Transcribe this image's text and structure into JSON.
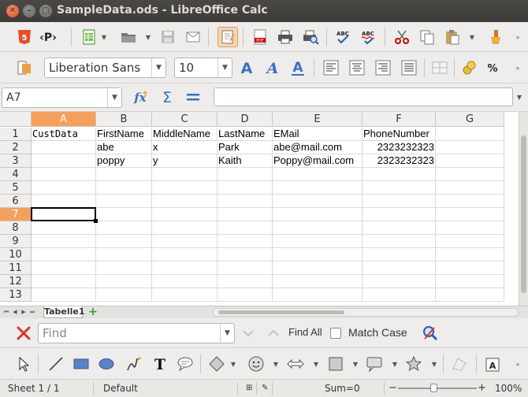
{
  "window": {
    "title": "SampleData.ods - LibreOffice Calc"
  },
  "formatting": {
    "font_name": "Liberation Sans",
    "font_size": "10"
  },
  "formula_bar": {
    "name_box": "A7",
    "content": ""
  },
  "sheet": {
    "columns": [
      "A",
      "B",
      "C",
      "D",
      "E",
      "F",
      "G"
    ],
    "rows": [
      "1",
      "2",
      "3",
      "4",
      "5",
      "6",
      "7",
      "8",
      "9",
      "10",
      "11",
      "12",
      "13"
    ],
    "selected_cell": "A7",
    "cells": {
      "r1": [
        "CustData",
        "FirstName",
        "MiddleName",
        "LastName",
        "EMail",
        "PhoneNumber",
        ""
      ],
      "r2": [
        "",
        "abe",
        "x",
        "Park",
        "abe@mail.com",
        "2323232323",
        ""
      ],
      "r3": [
        "",
        "poppy",
        "y",
        "Kaith",
        "Poppy@mail.com",
        "2323232323",
        ""
      ]
    },
    "tabs": [
      "Tabelle1"
    ]
  },
  "find_toolbar": {
    "placeholder": "Find",
    "find_all": "Find All",
    "match_case": "Match Case"
  },
  "status": {
    "sheet": "Sheet 1 / 1",
    "style": "Default",
    "sum": "Sum=0",
    "zoom": "100%"
  },
  "colors": {
    "accent": "#f5a05a",
    "titlebar": "#3c3b37",
    "close": "#e1522d"
  }
}
